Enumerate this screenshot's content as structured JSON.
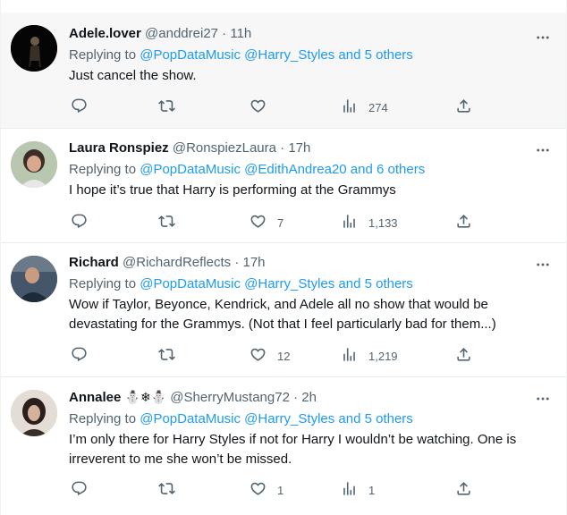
{
  "tweets": [
    {
      "name": "Adele.lover",
      "handle": "@anddrei27",
      "dot": "·",
      "time": "11h",
      "replying_prefix": "Replying to ",
      "mentions": "@PopDataMusic @Harry_Styles and 5 others",
      "text": "Just cancel the show.",
      "replies": "",
      "retweets": "",
      "likes": "",
      "views": "274"
    },
    {
      "name": "Laura Ronspiez",
      "handle": "@RonspiezLaura",
      "dot": "·",
      "time": "17h",
      "replying_prefix": "Replying to ",
      "mentions": "@PopDataMusic @EdithAndrea20 and 6 others",
      "text": "I hope it’s true that Harry is performing at the Grammys",
      "replies": "",
      "retweets": "",
      "likes": "7",
      "views": "1,133"
    },
    {
      "name": "Richard",
      "handle": "@RichardReflects",
      "dot": "·",
      "time": "17h",
      "replying_prefix": "Replying to ",
      "mentions": "@PopDataMusic @Harry_Styles and 5 others",
      "text": "Wow if Taylor, Beyonce, Kendrick, and Adele all no show that would be devastating for the Grammys. (Not that I feel particularly bad for them...)",
      "replies": "",
      "retweets": "",
      "likes": "12",
      "views": "1,219"
    },
    {
      "name": "Annalee",
      "emojis": "⛄❄⛄",
      "handle": "@SherryMustang72",
      "dot": "·",
      "time": "2h",
      "replying_prefix": "Replying to ",
      "mentions": "@PopDataMusic @Harry_Styles and 5 others",
      "text": "I’m only there for Harry Styles if not for Harry I wouldn’t be watching. One is irreverent to me she won’t be missed.",
      "replies": "",
      "retweets": "",
      "likes": "1",
      "views": "1"
    }
  ],
  "colors": {
    "link": "#1d9bf0",
    "muted": "#536471",
    "text": "#0f1419",
    "highlight_bg": "#f7f7f7",
    "divider": "#e6ecf0"
  },
  "icons": [
    "avatar",
    "more-icon",
    "reply-icon",
    "retweet-icon",
    "like-icon",
    "views-icon",
    "share-icon"
  ]
}
